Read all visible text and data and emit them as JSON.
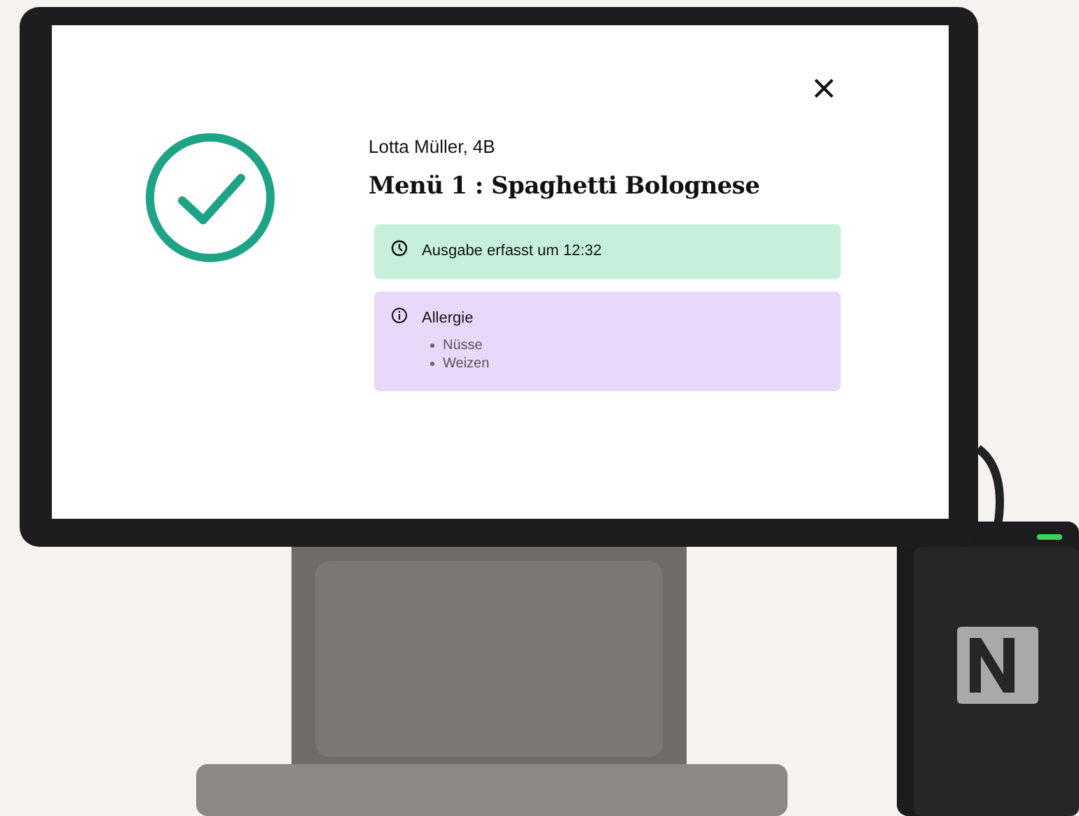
{
  "screen": {
    "customer": "Lotta Müller, 4B",
    "title": "Menü 1 : Spaghetti Bolognese",
    "notices": [
      {
        "kind": "status",
        "text": "Ausgabe erfasst um 12:32"
      },
      {
        "kind": "allergy",
        "title": "Allergie",
        "items": [
          "Nüsse",
          "Weizen"
        ]
      }
    ]
  }
}
